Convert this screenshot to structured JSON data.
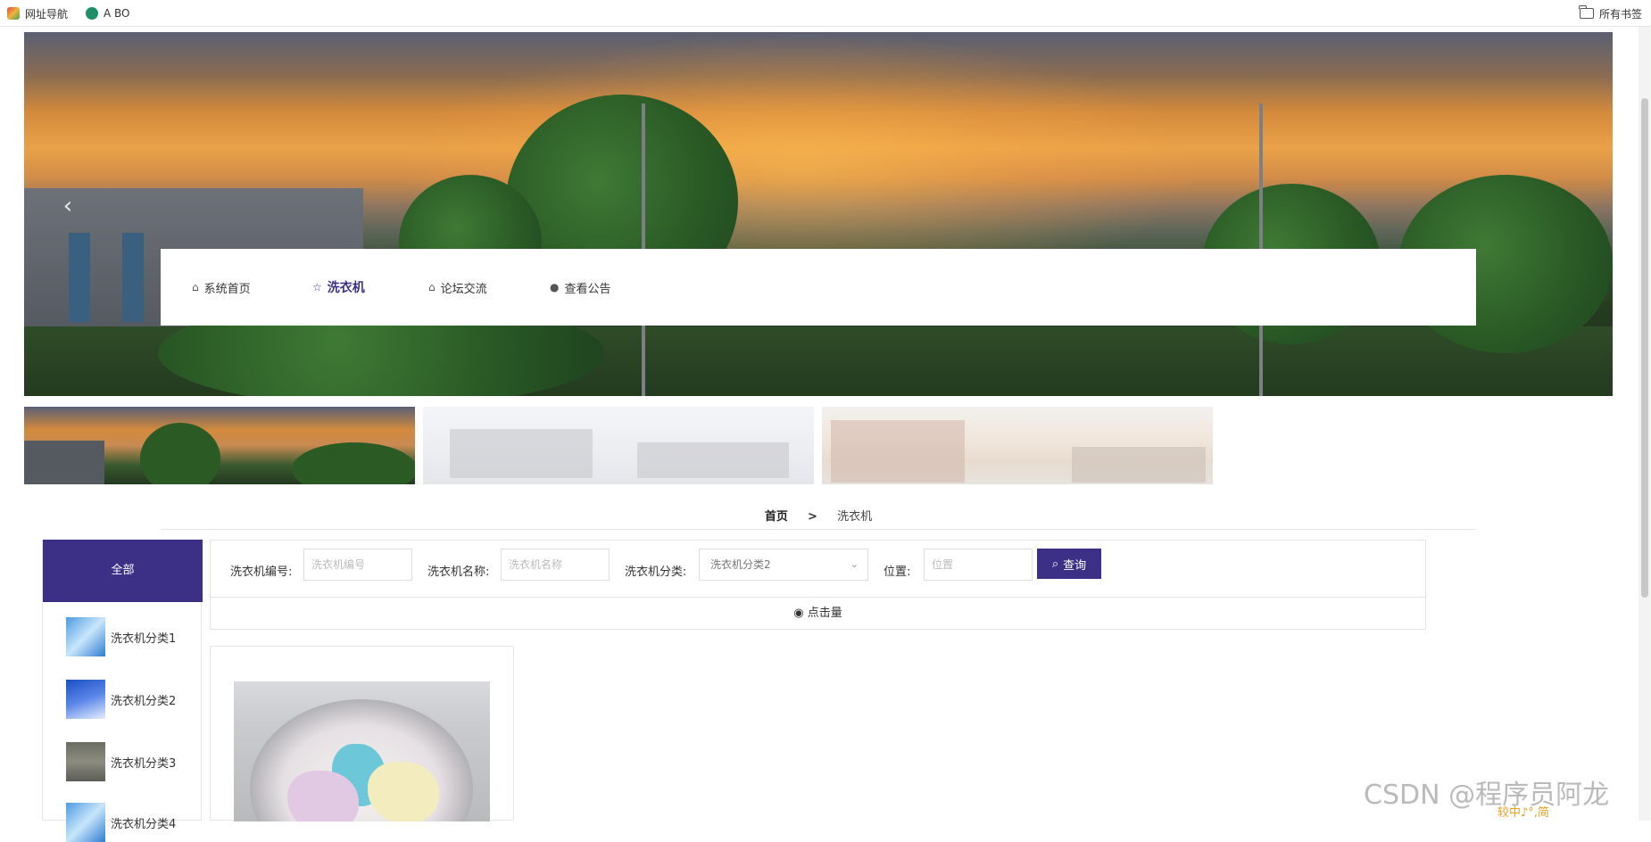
{
  "bookmarks": {
    "left": [
      {
        "label": "网址导航",
        "icon": "home-nav-icon"
      },
      {
        "label": "A BO",
        "icon": "app-icon"
      }
    ],
    "right": {
      "label": "所有书签",
      "icon": "folder-icon"
    }
  },
  "nav": {
    "items": [
      {
        "label": "系统首页",
        "icon": "home-icon",
        "active": false
      },
      {
        "label": "洗衣机",
        "icon": "star-icon",
        "active": true
      },
      {
        "label": "论坛交流",
        "icon": "bag-icon",
        "active": false
      },
      {
        "label": "查看公告",
        "icon": "info-icon",
        "active": false
      }
    ]
  },
  "breadcrumb": {
    "home": "首页",
    "separator": ">",
    "current": "洗衣机"
  },
  "sidebar": {
    "all_label": "全部",
    "items": [
      {
        "label": "洗衣机分类1"
      },
      {
        "label": "洗衣机分类2"
      },
      {
        "label": "洗衣机分类3"
      },
      {
        "label": "洗衣机分类4"
      }
    ]
  },
  "search": {
    "number_label": "洗衣机编号:",
    "number_placeholder": "洗衣机编号",
    "name_label": "洗衣机名称:",
    "name_placeholder": "洗衣机名称",
    "category_label": "洗衣机分类:",
    "category_selected": "洗衣机分类2",
    "location_label": "位置:",
    "location_placeholder": "位置",
    "query_button": "查询",
    "sort_label": "点击量"
  },
  "watermark": "CSDN @程序员阿龙",
  "ime": "较中♪°,简",
  "colors": {
    "accent": "#3b2f86"
  }
}
